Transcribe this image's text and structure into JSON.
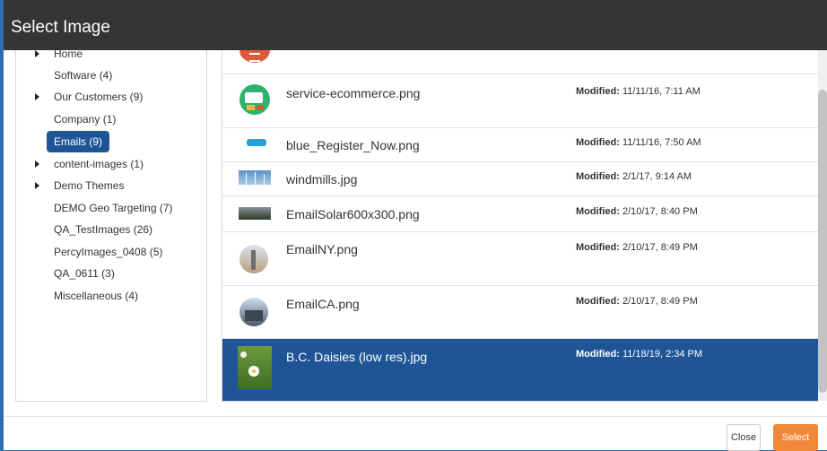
{
  "dialog": {
    "title": "Select Image"
  },
  "tree": {
    "items": [
      {
        "label": "Home",
        "has_children": true,
        "selected": false
      },
      {
        "label": "Software (4)",
        "has_children": false,
        "selected": false
      },
      {
        "label": "Our Customers (9)",
        "has_children": true,
        "selected": false
      },
      {
        "label": "Company (1)",
        "has_children": false,
        "selected": false
      },
      {
        "label": "Emails (9)",
        "has_children": false,
        "selected": true
      },
      {
        "label": "content-images (1)",
        "has_children": true,
        "selected": false
      },
      {
        "label": "Demo Themes",
        "has_children": true,
        "selected": false
      },
      {
        "label": "DEMO Geo Targeting (7)",
        "has_children": false,
        "selected": false
      },
      {
        "label": "QA_TestImages (26)",
        "has_children": false,
        "selected": false
      },
      {
        "label": "PercyImages_0408 (5)",
        "has_children": false,
        "selected": false
      },
      {
        "label": "QA_0611 (3)",
        "has_children": false,
        "selected": false
      },
      {
        "label": "Miscellaneous (4)",
        "has_children": false,
        "selected": false
      }
    ]
  },
  "files": {
    "modified_label": "Modified:",
    "rows": [
      {
        "name": "service-ecommerce.png",
        "date": "11/11/16, 7:11 AM",
        "selected": false
      },
      {
        "name": "blue_Register_Now.png",
        "date": "11/11/16, 7:50 AM",
        "selected": false
      },
      {
        "name": "windmills.jpg",
        "date": "2/1/17, 9:14 AM",
        "selected": false
      },
      {
        "name": "EmailSolar600x300.png",
        "date": "2/10/17, 8:40 PM",
        "selected": false
      },
      {
        "name": "EmailNY.png",
        "date": "2/10/17, 8:49 PM",
        "selected": false
      },
      {
        "name": "EmailCA.png",
        "date": "2/10/17, 8:49 PM",
        "selected": false
      },
      {
        "name": "B.C. Daisies (low res).jpg",
        "date": "11/18/19, 2:34 PM",
        "selected": true
      }
    ]
  },
  "footer": {
    "close_label": "Close",
    "select_label": "Select"
  },
  "colors": {
    "accent": "#1f5597",
    "select_button": "#f0883a",
    "titlebar": "#353535"
  }
}
